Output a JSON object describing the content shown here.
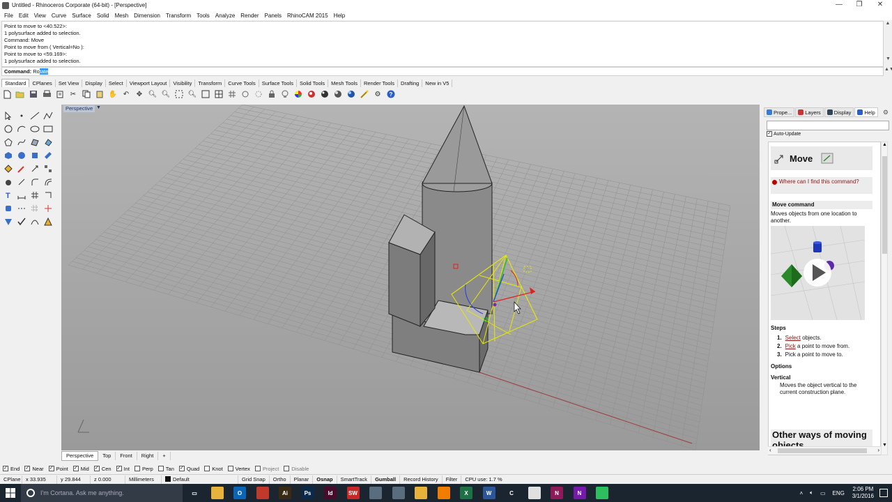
{
  "window": {
    "title": "Untitled - Rhinoceros Corporate (64-bit) - [Perspective]",
    "controls": [
      "—",
      "❐",
      "✕"
    ]
  },
  "menu": [
    "File",
    "Edit",
    "View",
    "Curve",
    "Surface",
    "Solid",
    "Mesh",
    "Dimension",
    "Transform",
    "Tools",
    "Analyze",
    "Render",
    "Panels",
    "RhinoCAM 2015",
    "Help"
  ],
  "command_history": [
    "Point to move to <40.522>:",
    "1 polysurface added to selection.",
    "Command: Move",
    "Point to move from ( Vertical=No ):",
    "Point to move to <59.169>:",
    "1 polysurface added to selection."
  ],
  "command_line": {
    "prompt": "Command:",
    "typed": "Ro",
    "autocomplete": "tate"
  },
  "toolbar_tabs": [
    "Standard",
    "CPlanes",
    "Set View",
    "Display",
    "Select",
    "Viewport Layout",
    "Visibility",
    "Transform",
    "Curve Tools",
    "Surface Tools",
    "Solid Tools",
    "Mesh Tools",
    "Render Tools",
    "Drafting",
    "New in V5"
  ],
  "toolbar_icons": [
    "new-file-icon",
    "open-icon",
    "save-icon",
    "print-icon",
    "import-icon",
    "cut-icon",
    "copy-icon",
    "paste-icon",
    "pan-hand-icon",
    "undo-icon",
    "rotate-view-icon",
    "zoom-icon",
    "zoom-window-icon",
    "zoom-extents-icon",
    "zoom-selected-icon",
    "zoom-all-icon",
    "viewport-4-icon",
    "grid-icon",
    "select-points-icon",
    "options-icon",
    "lock-icon",
    "light-bulb-icon",
    "color-wheel-icon",
    "material-icon",
    "shaded-sphere-icon",
    "render-sphere-icon",
    "settings-wand-icon",
    "gear-options-icon",
    "help-icon"
  ],
  "viewport": {
    "label": "Perspective",
    "tabs": [
      "Perspective",
      "Top",
      "Front",
      "Right",
      "+"
    ],
    "active_tab": "Perspective"
  },
  "panel": {
    "tabs": [
      "Prope...",
      "Layers",
      "Display",
      "Help"
    ],
    "active_tab": "Help",
    "auto_update_label": "Auto-Update",
    "auto_update_checked": true
  },
  "help": {
    "title": "Move",
    "where_link": "Where can I find this command?",
    "command_header": "Move command",
    "description": "Moves objects from one location to another.",
    "steps_header": "Steps",
    "steps": [
      {
        "num": "1.",
        "link": "Select",
        "rest": " objects."
      },
      {
        "num": "2.",
        "link": "Pick",
        "rest": " a point to move from."
      },
      {
        "num": "3.",
        "link": "",
        "rest": "Pick a point to move to."
      }
    ],
    "options_header": "Options",
    "option_name": "Vertical",
    "option_desc": "Moves the object vertical to the current construction plane.",
    "other_ways": "Other ways of moving objects"
  },
  "osnap": [
    {
      "label": "End",
      "checked": true
    },
    {
      "label": "Near",
      "checked": true
    },
    {
      "label": "Point",
      "checked": true
    },
    {
      "label": "Mid",
      "checked": true
    },
    {
      "label": "Cen",
      "checked": true
    },
    {
      "label": "Int",
      "checked": true
    },
    {
      "label": "Perp",
      "checked": false
    },
    {
      "label": "Tan",
      "checked": false
    },
    {
      "label": "Quad",
      "checked": true
    },
    {
      "label": "Knot",
      "checked": false
    },
    {
      "label": "Vertex",
      "checked": false
    },
    {
      "label": "Project",
      "checked": false,
      "disabled": true
    },
    {
      "label": "Disable",
      "checked": false,
      "disabled": true
    }
  ],
  "status": {
    "cplane": "CPlane",
    "x": "x 33.935",
    "y": "y 29.844",
    "z": "z 0.000",
    "units": "Millimeters",
    "layer": "Default",
    "grid_snap": "Grid Snap",
    "ortho": "Ortho",
    "planar": "Planar",
    "osnap": "Osnap",
    "smarttrack": "SmartTrack",
    "gumball": "Gumball",
    "record_history": "Record History",
    "filter": "Filter",
    "cpu": "CPU use: 1.7 %"
  },
  "taskbar": {
    "search_placeholder": "I'm Cortana. Ask me anything.",
    "apps": [
      {
        "name": "task-view",
        "label": "▭",
        "color": "#1b2530"
      },
      {
        "name": "file-explorer",
        "label": "",
        "color": "#e8b33a"
      },
      {
        "name": "outlook",
        "label": "O",
        "color": "#0a64b8"
      },
      {
        "name": "solidworks-ds",
        "label": "",
        "color": "#c0392b"
      },
      {
        "name": "illustrator",
        "label": "Ai",
        "color": "#3a2a14"
      },
      {
        "name": "photoshop",
        "label": "Ps",
        "color": "#0b2a4a"
      },
      {
        "name": "indesign",
        "label": "Id",
        "color": "#4a0b2a"
      },
      {
        "name": "solidworks",
        "label": "SW",
        "color": "#c62828"
      },
      {
        "name": "chrome-like",
        "label": "",
        "color": "#5a6d7f"
      },
      {
        "name": "rhino",
        "label": "",
        "color": "#5a6d7f"
      },
      {
        "name": "folder",
        "label": "",
        "color": "#e8b33a"
      },
      {
        "name": "vlc",
        "label": "",
        "color": "#f07c00"
      },
      {
        "name": "excel",
        "label": "X",
        "color": "#1e7145"
      },
      {
        "name": "word",
        "label": "W",
        "color": "#2b579a"
      },
      {
        "name": "cortana-c",
        "label": "C",
        "color": "#1b2530"
      },
      {
        "name": "chrome",
        "label": "",
        "color": "#e0e0e0"
      },
      {
        "name": "rhinocam",
        "label": "N",
        "color": "#8e1a5a"
      },
      {
        "name": "onenote",
        "label": "N",
        "color": "#7719aa"
      },
      {
        "name": "evernote",
        "label": "",
        "color": "#2dbe60"
      },
      {
        "name": "pen-tool",
        "label": "",
        "color": "#1b2530"
      }
    ],
    "tray": {
      "lang": "ENG",
      "time": "2:06 PM",
      "date": "3/1/2016"
    }
  },
  "colors": {
    "viewport_bg": "#a3a3a3",
    "gumball_x": "#e02020",
    "gumball_y": "#20c020",
    "gumball_z": "#2040e0",
    "selection": "#e8e800",
    "taskbar": "#1b2530"
  }
}
